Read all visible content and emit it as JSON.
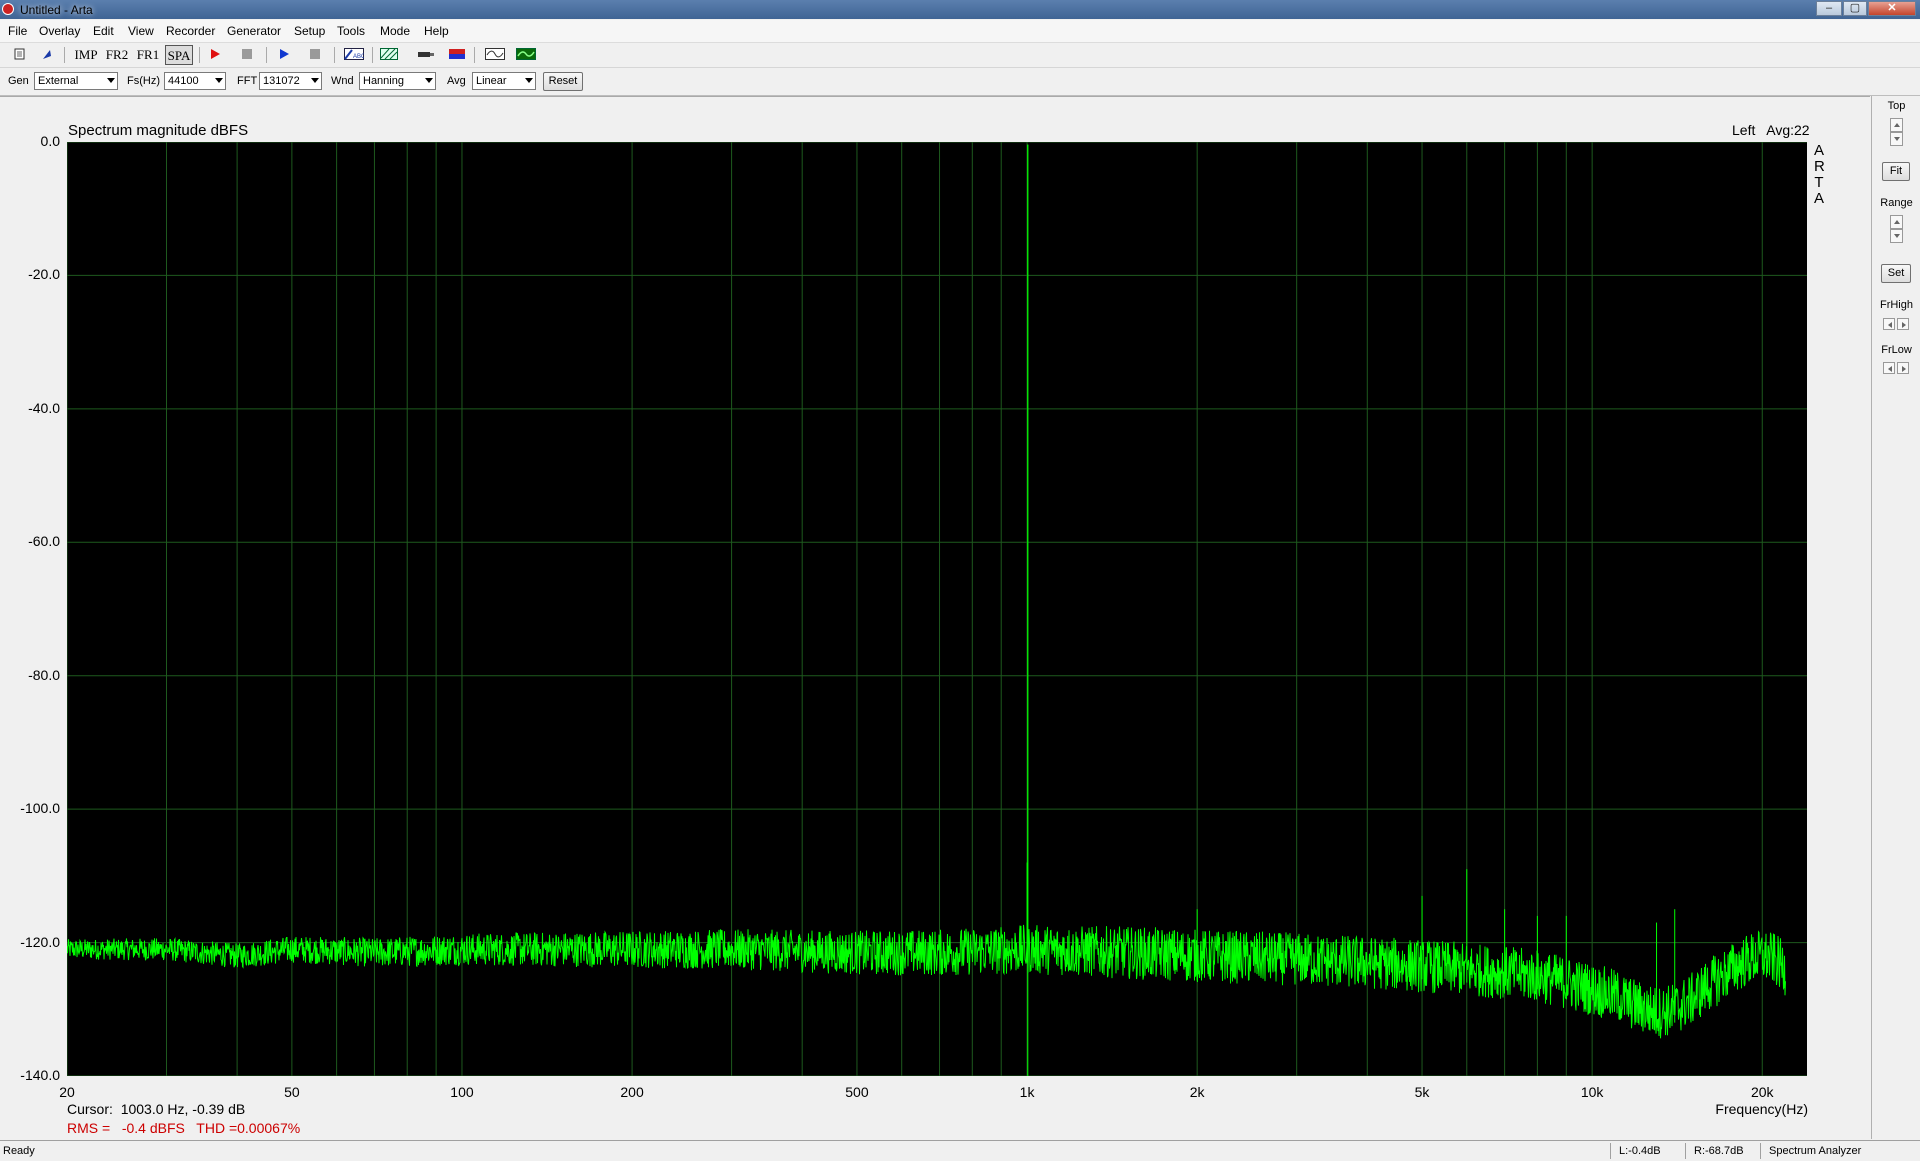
{
  "window": {
    "title": "Untitled - Arta",
    "minimize": "–",
    "maximize": "▢",
    "close": "✕"
  },
  "menu": [
    "File",
    "Overlay",
    "Edit",
    "View",
    "Recorder",
    "Generator",
    "Setup",
    "Tools",
    "Mode",
    "Help"
  ],
  "toolbar": {
    "imp": "IMP",
    "fr2": "FR2",
    "fr1": "FR1",
    "spa": "SPA"
  },
  "controls": {
    "gen_label": "Gen",
    "gen_value": "External",
    "fs_label": "Fs(Hz)",
    "fs_value": "44100",
    "fft_label": "FFT",
    "fft_value": "131072",
    "wnd_label": "Wnd",
    "wnd_value": "Hanning",
    "avg_label": "Avg",
    "avg_value": "Linear",
    "reset": "Reset"
  },
  "right_panel": {
    "top": "Top",
    "fit": "Fit",
    "range": "Range",
    "set": "Set",
    "frhigh": "FrHigh",
    "frlow": "FrLow"
  },
  "status": {
    "ready": "Ready",
    "left_level": "L:-0.4dB",
    "right_level": "R:-68.7dB",
    "mode": "Spectrum Analyzer"
  },
  "colors": {
    "trace": "#00ff00",
    "grid": "#1e5a1e",
    "background": "#000000",
    "rms_text": "#cc0000"
  },
  "chart_data": {
    "type": "line",
    "title": "Spectrum magnitude dBFS",
    "channel_info": "Left   Avg:22",
    "side_label": "ARTA",
    "xlabel": "Frequency(Hz)",
    "ylabel": "",
    "x_scale": "log",
    "xlim": [
      20,
      24000
    ],
    "ylim": [
      -140,
      0
    ],
    "x_ticks": [
      20,
      50,
      100,
      200,
      500,
      1000,
      2000,
      5000,
      10000,
      20000
    ],
    "x_tick_labels": [
      "20",
      "50",
      "100",
      "200",
      "500",
      "1k",
      "2k",
      "5k",
      "10k",
      "20k"
    ],
    "y_ticks": [
      0,
      -20,
      -40,
      -60,
      -80,
      -100,
      -120,
      -140
    ],
    "y_tick_labels": [
      "0.0",
      "-20.0",
      "-40.0",
      "-60.0",
      "-80.0",
      "-100.0",
      "-120.0",
      "-140.0"
    ],
    "grid": true,
    "series": [
      {
        "points": [
          [
            20,
            -121
          ],
          [
            30,
            -121
          ],
          [
            40,
            -122
          ],
          [
            50,
            -121
          ],
          [
            70,
            -121.5
          ],
          [
            100,
            -121
          ],
          [
            150,
            -121
          ],
          [
            200,
            -121
          ],
          [
            300,
            -121
          ],
          [
            500,
            -121.5
          ],
          [
            700,
            -121.5
          ],
          [
            1000,
            -121
          ],
          [
            1500,
            -121.5
          ],
          [
            2000,
            -122
          ],
          [
            3000,
            -122.5
          ],
          [
            4000,
            -123
          ],
          [
            5000,
            -123.5
          ],
          [
            6000,
            -124
          ],
          [
            7000,
            -124.5
          ],
          [
            8000,
            -125
          ],
          [
            9000,
            -126
          ],
          [
            10000,
            -127
          ],
          [
            11000,
            -128
          ],
          [
            12000,
            -129.5
          ],
          [
            13000,
            -130.5
          ],
          [
            14000,
            -130
          ],
          [
            15000,
            -128.5
          ],
          [
            16000,
            -126.5
          ],
          [
            17000,
            -125
          ],
          [
            18000,
            -123.5
          ],
          [
            19000,
            -122.5
          ],
          [
            20000,
            -122
          ],
          [
            21000,
            -122.5
          ],
          [
            22000,
            -124
          ]
        ],
        "peaks": [
          [
            1003,
            -0.39
          ],
          [
            1000,
            -108
          ],
          [
            1180,
            -119
          ],
          [
            2000,
            -115
          ],
          [
            5000,
            -113
          ],
          [
            6000,
            -109
          ],
          [
            7000,
            -115
          ],
          [
            8000,
            -116
          ],
          [
            9000,
            -116
          ],
          [
            13000,
            -117
          ],
          [
            14000,
            -115
          ]
        ]
      }
    ]
  },
  "readout": {
    "cursor_label": "Cursor:",
    "cursor_value": "1003.0 Hz, -0.39 dB",
    "rms_line": "RMS =   -0.4 dBFS   THD =0.00067%"
  }
}
